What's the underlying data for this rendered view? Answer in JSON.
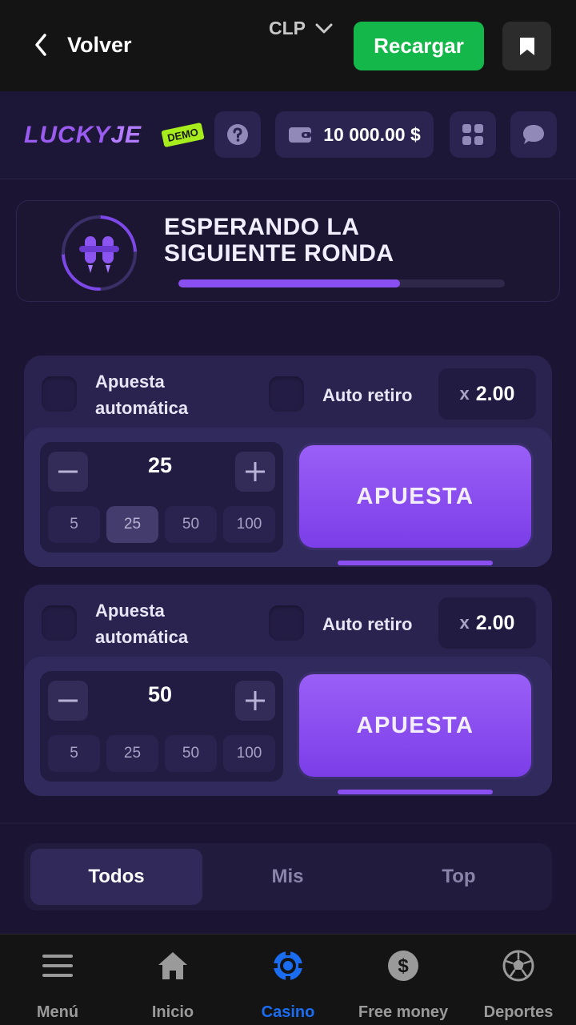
{
  "topbar": {
    "back_label": "Volver",
    "currency": "CLP",
    "recharge_label": "Recargar"
  },
  "game": {
    "logo_text_a": "LUCKY",
    "logo_text_b": "JE",
    "demo_badge": "DEMO",
    "balance": "10 000.00 $"
  },
  "waiting": {
    "title": "ESPERANDO LA SIGUIENTE RONDA",
    "progress_percent": 68
  },
  "bets": [
    {
      "auto_bet_label": "Apuesta automática",
      "auto_cashout_label": "Auto retiro",
      "multiplier_prefix": "x",
      "multiplier": "2.00",
      "amount": "25",
      "quick_amounts": [
        "5",
        "25",
        "50",
        "100"
      ],
      "active_quick": 1,
      "bet_label": "APUESTA"
    },
    {
      "auto_bet_label": "Apuesta automática",
      "auto_cashout_label": "Auto retiro",
      "multiplier_prefix": "x",
      "multiplier": "2.00",
      "amount": "50",
      "quick_amounts": [
        "5",
        "25",
        "50",
        "100"
      ],
      "active_quick": -1,
      "bet_label": "APUESTA"
    }
  ],
  "tabs": [
    "Todos",
    "Mis",
    "Top"
  ],
  "bottom_nav": [
    {
      "label": "Menú",
      "icon": "menu-icon"
    },
    {
      "label": "Inicio",
      "icon": "home-icon"
    },
    {
      "label": "Casino",
      "icon": "casino-chip-icon",
      "active": true
    },
    {
      "label": "Free money",
      "icon": "dollar-coin-icon"
    },
    {
      "label": "Deportes",
      "icon": "soccer-ball-icon"
    }
  ],
  "colors": {
    "accent_purple": "#8a4ff0",
    "recharge_green": "#14b84a",
    "active_nav_blue": "#1a6cf0",
    "demo_lime": "#a7ec1c"
  }
}
